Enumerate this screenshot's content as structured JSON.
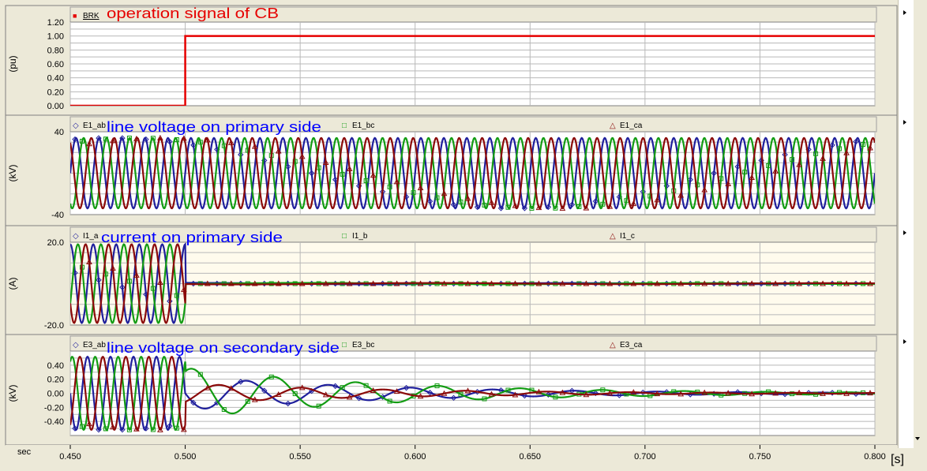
{
  "x_axis": {
    "unit_label": "sec",
    "ticks": [
      "0.450",
      "0.500",
      "0.550",
      "0.600",
      "0.650",
      "0.700",
      "0.750",
      "0.800"
    ],
    "range": [
      0.45,
      0.8
    ],
    "extra_label": "[s]"
  },
  "colors": {
    "panel_bg_plain": "#ffffff",
    "panel_bg_tint": "#fffbed",
    "grid": "#b8b8b8",
    "frame": "#808080",
    "header_bg": "#ece9d8",
    "red_curve": "#e60000",
    "blue_curve": "#1f1f9c",
    "green_curve": "#139c13",
    "dark_red_curve": "#8b0a0a",
    "annotation_red": "#e60000",
    "annotation_blue": "#0000ff"
  },
  "chart_data": [
    {
      "type": "line",
      "title": "",
      "ylabel": "(pu)",
      "ylim": [
        0,
        1.2
      ],
      "y_ticks": [
        "1.20",
        "1.00",
        "0.80",
        "0.60",
        "0.40",
        "0.20",
        "0.00"
      ],
      "legend": [
        {
          "symbol": "■",
          "name": "BRK",
          "color": "red_curve"
        }
      ],
      "annotation": {
        "text": "operation signal of CB",
        "color": "annotation_red"
      },
      "series": [
        {
          "name": "BRK",
          "color": "red_curve",
          "kind": "step",
          "before": 0.0,
          "after": 1.0,
          "switch_time": 0.5
        }
      ]
    },
    {
      "type": "line",
      "title": "",
      "ylabel": "(kV)",
      "ylim": [
        -40,
        40
      ],
      "y_ticks": [
        "40",
        "-40"
      ],
      "legend": [
        {
          "symbol": "◇",
          "name": "E1_ab",
          "color": "blue_curve"
        },
        {
          "symbol": "□",
          "name": "E1_bc",
          "color": "green_curve"
        },
        {
          "symbol": "△",
          "name": "E1_ca",
          "color": "dark_red_curve"
        }
      ],
      "annotation": {
        "text": "line voltage on primary side",
        "color": "annotation_blue"
      },
      "series": [
        {
          "name": "E1_ab",
          "color": "blue_curve",
          "kind": "sine",
          "amplitude": 34,
          "frequency_hz": 100,
          "phase_deg": 0
        },
        {
          "name": "E1_bc",
          "color": "green_curve",
          "kind": "sine",
          "amplitude": 34,
          "frequency_hz": 100,
          "phase_deg": -120
        },
        {
          "name": "E1_ca",
          "color": "dark_red_curve",
          "kind": "sine",
          "amplitude": 34,
          "frequency_hz": 100,
          "phase_deg": 120
        }
      ]
    },
    {
      "type": "line",
      "title": "",
      "ylabel": "(A)",
      "ylim": [
        -20,
        20
      ],
      "y_ticks": [
        "20.0",
        "-20.0"
      ],
      "legend": [
        {
          "symbol": "◇",
          "name": "I1_a",
          "color": "blue_curve"
        },
        {
          "symbol": "□",
          "name": "I1_b",
          "color": "green_curve"
        },
        {
          "symbol": "△",
          "name": "I1_c",
          "color": "dark_red_curve"
        }
      ],
      "annotation": {
        "text": "current on primary side",
        "color": "annotation_blue"
      },
      "series": [
        {
          "name": "I1_a",
          "color": "blue_curve",
          "kind": "interrupted_sine",
          "amplitude": 19,
          "frequency_hz": 100,
          "phase_deg": 90,
          "cutoff": 0.5
        },
        {
          "name": "I1_b",
          "color": "green_curve",
          "kind": "interrupted_sine",
          "amplitude": 19,
          "frequency_hz": 100,
          "phase_deg": -30,
          "cutoff": 0.5
        },
        {
          "name": "I1_c",
          "color": "dark_red_curve",
          "kind": "interrupted_sine",
          "amplitude": 19,
          "frequency_hz": 100,
          "phase_deg": 210,
          "cutoff": 0.5
        }
      ]
    },
    {
      "type": "line",
      "title": "",
      "ylabel": "(kV)",
      "ylim": [
        -0.6,
        0.6
      ],
      "y_ticks": [
        "0.40",
        "0.20",
        "0.00",
        "-0.20",
        "-0.40"
      ],
      "legend": [
        {
          "symbol": "◇",
          "name": "E3_ab",
          "color": "blue_curve"
        },
        {
          "symbol": "□",
          "name": "E3_bc",
          "color": "green_curve"
        },
        {
          "symbol": "△",
          "name": "E3_ca",
          "color": "dark_red_curve"
        }
      ],
      "annotation": {
        "text": "line voltage on secondary side",
        "color": "annotation_blue"
      },
      "series": [
        {
          "name": "E3_ab",
          "color": "blue_curve",
          "kind": "decaying_sine",
          "amplitude": 0.52,
          "frequency_hz": 100,
          "phase_deg": 180,
          "cutoff": 0.5,
          "post_amplitude": 0.24,
          "post_frequency_hz": 28,
          "decay_tau": 0.09
        },
        {
          "name": "E3_bc",
          "color": "green_curve",
          "kind": "decaying_sine",
          "amplitude": 0.52,
          "frequency_hz": 100,
          "phase_deg": 60,
          "cutoff": 0.5,
          "post_amplitude": 0.36,
          "post_frequency_hz": 28,
          "decay_tau": 0.09
        },
        {
          "name": "E3_ca",
          "color": "dark_red_curve",
          "kind": "decaying_sine",
          "amplitude": 0.52,
          "frequency_hz": 100,
          "phase_deg": -60,
          "cutoff": 0.5,
          "post_amplitude": 0.14,
          "post_frequency_hz": 28,
          "decay_tau": 0.09
        }
      ]
    }
  ]
}
